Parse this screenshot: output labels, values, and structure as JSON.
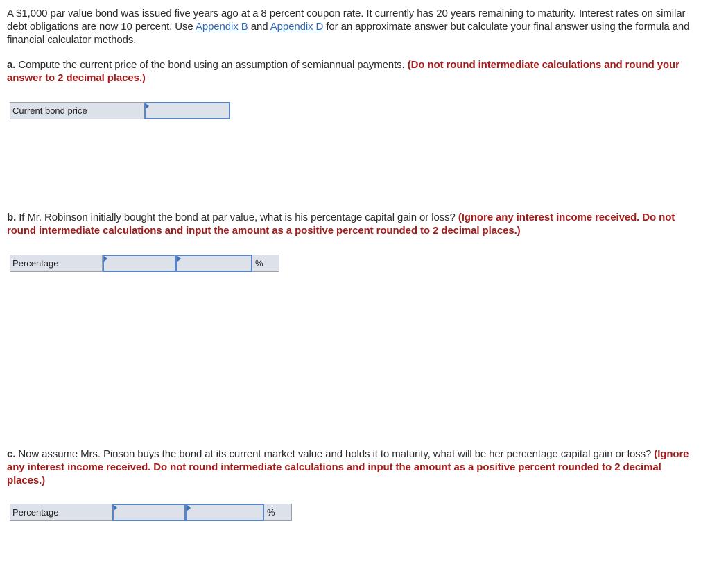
{
  "intro": {
    "text_1": "A $1,000 par value bond was issued five years ago at a 8 percent coupon rate. It currently has 20 years remaining to maturity. Interest rates on similar debt obligations are now 10 percent. Use ",
    "link_b": "Appendix B",
    "text_2": " and ",
    "link_d": "Appendix D",
    "text_3": " for an approximate answer but calculate your final answer using the formula and financial calculator methods."
  },
  "part_a": {
    "lead": "a.",
    "question": " Compute the current price of the bond using an assumption of semiannual payments. ",
    "instruction": "(Do not round intermediate calculations and round your answer to 2 decimal places.)",
    "row_label": "Current bond price",
    "value": ""
  },
  "part_b": {
    "lead": "b.",
    "question": " If Mr. Robinson initially bought the bond at par value, what is his percentage capital gain or loss? ",
    "instruction": "(Ignore any interest income received. Do not round intermediate calculations and input the amount as a positive percent rounded to 2 decimal places.)",
    "row_label": "Percentage",
    "value_1": "",
    "value_2": "",
    "unit": "%"
  },
  "part_c": {
    "lead": "c.",
    "question": " Now assume Mrs. Pinson buys the bond at its current market value and holds it to maturity, what will be her percentage capital gain or loss? ",
    "instruction": "(Ignore any interest income received. Do not round intermediate calculations and input the amount as a positive percent rounded to 2 decimal places.)",
    "row_label": "Percentage",
    "value_1": "",
    "value_2": "",
    "unit": "%"
  }
}
